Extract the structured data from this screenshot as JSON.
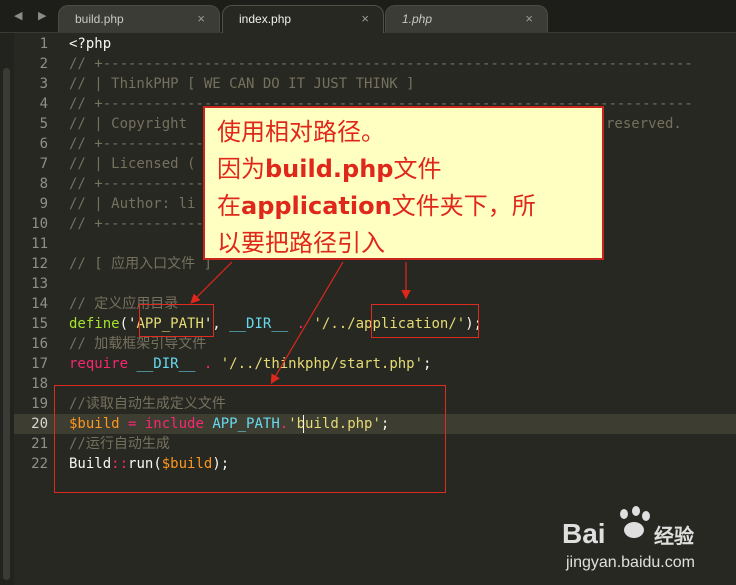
{
  "tabs": [
    {
      "label": "build.php",
      "close": "×"
    },
    {
      "label": "index.php",
      "close": "×"
    },
    {
      "label": "1.php",
      "close": "×"
    }
  ],
  "nav_arrows": "◀ ▶",
  "line_numbers": [
    "1",
    "2",
    "3",
    "4",
    "5",
    "6",
    "7",
    "8",
    "9",
    "10",
    "11",
    "12",
    "13",
    "14",
    "15",
    "16",
    "17",
    "18",
    "19",
    "20",
    "21",
    "22"
  ],
  "active_line": "20",
  "code": {
    "l1": "<?php",
    "l2": "// +----------------------------------------------------------------------",
    "l3": "// | ThinkPHP [ WE CAN DO IT JUST THINK ]",
    "l4": "// +----------------------------------------------------------------------",
    "l5": "// | Copyright",
    "l5b": "reserved.",
    "l6": "// +------------",
    "l7": "// | Licensed (",
    "l8": "// +------------",
    "l9": "// | Author: li",
    "l10": "// +------------",
    "l12": "// [ 应用入口文件 ]",
    "l14": "// 定义应用目录",
    "l15_define": "define",
    "l15_open": "('",
    "l15_name": "APP_PATH",
    "l15_mid": "', ",
    "l15_dir": "__DIR__",
    "l15_dot": " . ",
    "l15_str": "'/../application/'",
    "l15_end": ");",
    "l16": "// 加载框架引导文件",
    "l17_kw": "require",
    "l17_dir": " __DIR__",
    "l17_dot": " . ",
    "l17_str": "'/../thinkphp/start.php'",
    "l17_end": ";",
    "l19": "//读取自动生成定义文件",
    "l20_var": "$build",
    "l20_eq": " = ",
    "l20_kw": "include",
    "l20_const": " APP_PATH",
    "l20_dot": ".",
    "l20_str": "'build.php'",
    "l20_end": ";",
    "l21": "//运行自动生成",
    "l22_cls": "Build",
    "l22_sep": "::",
    "l22_fn": "run",
    "l22_open": "(",
    "l22_var": "$build",
    "l22_end": ");"
  },
  "callout": {
    "line1": "使用相对路径。",
    "line2_pre": "因为",
    "line2_bold": "build.php",
    "line2_post": "文件",
    "line3_pre": "在",
    "line3_bold": "application",
    "line3_post": "文件夹下，所",
    "line4": "以要把路径引入"
  },
  "watermark": {
    "brand": "Bai",
    "jingyan": "经验",
    "url": "jingyan.baidu.com"
  },
  "colors": {
    "background": "#272822",
    "annotation_red": "#e0271c",
    "callout_bg": "#ffffc2"
  }
}
